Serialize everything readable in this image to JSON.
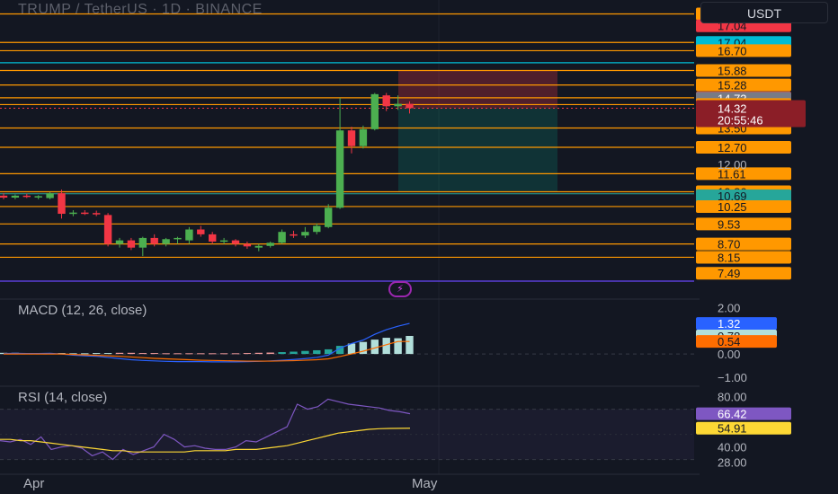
{
  "header": {
    "title": "TRUMP / TetherUS · 1D · BINANCE",
    "currency": "USDT"
  },
  "price_badges": [
    {
      "label": "18.22",
      "bg": "#ff9800",
      "fg": "#131722",
      "price": 18.22
    },
    {
      "label": "17.04",
      "bg": "#f23645",
      "fg": "#131722",
      "price": 17.73
    },
    {
      "label": "17.04",
      "bg": "#00bcd4",
      "fg": "#131722",
      "price": 17.04
    },
    {
      "label": "16.70",
      "bg": "#ff9800",
      "fg": "#131722",
      "price": 16.7
    },
    {
      "label": "15.88",
      "bg": "#ff9800",
      "fg": "#131722",
      "price": 15.88
    },
    {
      "label": "15.28",
      "bg": "#ff9800",
      "fg": "#131722",
      "price": 15.28
    },
    {
      "label": "14.75",
      "bg": "#f23645",
      "fg": "#131722",
      "price": 14.75
    },
    {
      "label": "14.73",
      "bg": "#787b86",
      "fg": "#ffffff",
      "price": 14.73
    },
    {
      "label": "14.47",
      "bg": "#ff9800",
      "fg": "#131722",
      "price": 14.47
    },
    {
      "label": "13.50",
      "bg": "#ff9800",
      "fg": "#131722",
      "price": 13.5
    },
    {
      "label": "12.70",
      "bg": "#ff9800",
      "fg": "#131722",
      "price": 12.7
    },
    {
      "label": "11.61",
      "bg": "#ff9800",
      "fg": "#131722",
      "price": 11.61
    },
    {
      "label": "10.86",
      "bg": "#ff9800",
      "fg": "#131722",
      "price": 10.86
    },
    {
      "label": "10.70",
      "bg": "#4caf50",
      "fg": "#131722",
      "price": 10.7
    },
    {
      "label": "10.69",
      "bg": "#26a69a",
      "fg": "#131722",
      "price": 10.69
    },
    {
      "label": "10.25",
      "bg": "#ff9800",
      "fg": "#131722",
      "price": 10.25
    },
    {
      "label": "9.53",
      "bg": "#ff9800",
      "fg": "#131722",
      "price": 9.53
    },
    {
      "label": "8.70",
      "bg": "#ff9800",
      "fg": "#131722",
      "price": 8.7
    },
    {
      "label": "8.15",
      "bg": "#ff9800",
      "fg": "#131722",
      "price": 8.15
    },
    {
      "label": "7.49",
      "bg": "#ff9800",
      "fg": "#131722",
      "price": 7.49
    }
  ],
  "current_price": {
    "label": "14.32",
    "countdown": "20:55:46",
    "price": 14.32
  },
  "axis_label_12": "12.00",
  "macd": {
    "label": "MACD (12, 26, close)",
    "axis": [
      "2.00",
      "0.00",
      "−1.00"
    ],
    "badges": [
      {
        "label": "1.32",
        "bg": "#2962ff",
        "fg": "#ffffff"
      },
      {
        "label": "0.78",
        "bg": "#b2dfdb",
        "fg": "#131722"
      },
      {
        "label": "0.54",
        "bg": "#ff6d00",
        "fg": "#131722"
      }
    ]
  },
  "rsi": {
    "label": "RSI (14, close)",
    "axis": [
      "80.00",
      "40.00",
      "28.00"
    ],
    "badges": [
      {
        "label": "66.42",
        "bg": "#7e57c2",
        "fg": "#ffffff"
      },
      {
        "label": "54.91",
        "bg": "#fdd835",
        "fg": "#131722"
      }
    ]
  },
  "time_axis": [
    "Apr",
    "May"
  ],
  "colors": {
    "background": "#131722",
    "up": "#4caf50",
    "down": "#f23645",
    "level_line": "#ff9800",
    "cyan_line": "#00bcd4",
    "purple_line": "#5b3fd6"
  },
  "chart_data": {
    "type": "candlestick",
    "candles": [
      {
        "o": 10.7,
        "h": 10.8,
        "l": 10.55,
        "c": 10.62
      },
      {
        "o": 10.62,
        "h": 10.75,
        "l": 10.55,
        "c": 10.7
      },
      {
        "o": 10.7,
        "h": 10.78,
        "l": 10.6,
        "c": 10.65
      },
      {
        "o": 10.65,
        "h": 10.72,
        "l": 10.55,
        "c": 10.68
      },
      {
        "o": 10.6,
        "h": 10.85,
        "l": 10.55,
        "c": 10.8
      },
      {
        "o": 10.8,
        "h": 10.95,
        "l": 9.75,
        "c": 9.95
      },
      {
        "o": 9.95,
        "h": 10.1,
        "l": 9.85,
        "c": 10.0
      },
      {
        "o": 10.0,
        "h": 10.1,
        "l": 9.9,
        "c": 9.98
      },
      {
        "o": 9.98,
        "h": 10.08,
        "l": 9.85,
        "c": 9.95
      },
      {
        "o": 9.9,
        "h": 9.98,
        "l": 8.6,
        "c": 8.7
      },
      {
        "o": 8.7,
        "h": 8.95,
        "l": 8.55,
        "c": 8.85
      },
      {
        "o": 8.85,
        "h": 8.95,
        "l": 8.45,
        "c": 8.55
      },
      {
        "o": 8.55,
        "h": 9.0,
        "l": 8.2,
        "c": 8.95
      },
      {
        "o": 8.95,
        "h": 9.1,
        "l": 8.6,
        "c": 8.7
      },
      {
        "o": 8.7,
        "h": 8.95,
        "l": 8.6,
        "c": 8.9
      },
      {
        "o": 8.9,
        "h": 9.0,
        "l": 8.7,
        "c": 8.95
      },
      {
        "o": 8.85,
        "h": 9.4,
        "l": 8.7,
        "c": 9.3
      },
      {
        "o": 9.3,
        "h": 9.45,
        "l": 9.0,
        "c": 9.1
      },
      {
        "o": 9.1,
        "h": 9.2,
        "l": 8.7,
        "c": 8.8
      },
      {
        "o": 8.8,
        "h": 8.95,
        "l": 8.7,
        "c": 8.85
      },
      {
        "o": 8.85,
        "h": 8.9,
        "l": 8.6,
        "c": 8.7
      },
      {
        "o": 8.7,
        "h": 8.8,
        "l": 8.5,
        "c": 8.6
      },
      {
        "o": 8.55,
        "h": 8.7,
        "l": 8.4,
        "c": 8.62
      },
      {
        "o": 8.62,
        "h": 8.8,
        "l": 8.55,
        "c": 8.75
      },
      {
        "o": 8.75,
        "h": 9.3,
        "l": 8.7,
        "c": 9.2
      },
      {
        "o": 9.1,
        "h": 9.25,
        "l": 8.95,
        "c": 9.05
      },
      {
        "o": 9.05,
        "h": 9.4,
        "l": 8.95,
        "c": 9.2
      },
      {
        "o": 9.2,
        "h": 9.55,
        "l": 9.1,
        "c": 9.45
      },
      {
        "o": 9.4,
        "h": 10.35,
        "l": 9.35,
        "c": 10.2
      },
      {
        "o": 10.2,
        "h": 14.75,
        "l": 10.15,
        "c": 13.4
      },
      {
        "o": 13.4,
        "h": 13.55,
        "l": 12.45,
        "c": 12.75
      },
      {
        "o": 12.75,
        "h": 13.6,
        "l": 12.65,
        "c": 13.45
      },
      {
        "o": 13.45,
        "h": 14.95,
        "l": 13.4,
        "c": 14.9
      },
      {
        "o": 14.85,
        "h": 14.95,
        "l": 14.2,
        "c": 14.4
      },
      {
        "o": 14.4,
        "h": 14.85,
        "l": 14.25,
        "c": 14.5
      },
      {
        "o": 14.5,
        "h": 14.6,
        "l": 14.1,
        "c": 14.32
      }
    ],
    "ylim": [
      7.2,
      18.5
    ],
    "levels": [
      18.22,
      17.04,
      16.7,
      15.88,
      15.28,
      14.75,
      14.47,
      14.32,
      13.5,
      12.7,
      11.61,
      10.86,
      10.25,
      9.53,
      8.7,
      8.15
    ],
    "macd_line": [
      0.02,
      0.03,
      0.02,
      0.02,
      0.03,
      0.0,
      -0.05,
      -0.08,
      -0.1,
      -0.15,
      -0.2,
      -0.25,
      -0.28,
      -0.3,
      -0.32,
      -0.33,
      -0.33,
      -0.33,
      -0.34,
      -0.34,
      -0.34,
      -0.33,
      -0.32,
      -0.3,
      -0.27,
      -0.24,
      -0.2,
      -0.15,
      -0.05,
      0.25,
      0.45,
      0.6,
      0.85,
      1.05,
      1.2,
      1.32
    ],
    "signal_line": [
      0.0,
      0.0,
      0.0,
      0.0,
      0.0,
      0.0,
      -0.02,
      -0.04,
      -0.06,
      -0.08,
      -0.1,
      -0.13,
      -0.16,
      -0.19,
      -0.21,
      -0.23,
      -0.25,
      -0.27,
      -0.28,
      -0.29,
      -0.3,
      -0.31,
      -0.31,
      -0.31,
      -0.3,
      -0.29,
      -0.27,
      -0.25,
      -0.21,
      -0.11,
      0.0,
      0.12,
      0.26,
      0.4,
      0.54,
      0.54
    ],
    "histogram": [
      0.05,
      0.05,
      0.04,
      0.04,
      0.04,
      0.04,
      0.03,
      0.03,
      0.04,
      0.04,
      0.05,
      0.05,
      0.04,
      0.04,
      0.03,
      0.03,
      0.03,
      0.03,
      0.03,
      0.03,
      0.03,
      0.04,
      0.05,
      0.06,
      0.08,
      0.1,
      0.13,
      0.16,
      0.2,
      0.35,
      0.45,
      0.52,
      0.62,
      0.7,
      0.68,
      0.78
    ],
    "macd_ylim": [
      -1.2,
      2.1
    ],
    "rsi_line": [
      45,
      44,
      46,
      42,
      48,
      38,
      40,
      41,
      39,
      33,
      36,
      30,
      38,
      34,
      37,
      40,
      50,
      46,
      40,
      41,
      39,
      38,
      38,
      40,
      45,
      44,
      48,
      52,
      56,
      74,
      70,
      72,
      78,
      76,
      74,
      73,
      72,
      71,
      69,
      68,
      66.42
    ],
    "rsi_ma": [
      46,
      46,
      45,
      45,
      44,
      43,
      42,
      41,
      40,
      39,
      38,
      37,
      37,
      36,
      36,
      36,
      36,
      36,
      36,
      37,
      37,
      37,
      37,
      38,
      38,
      38,
      39,
      40,
      41,
      43,
      45,
      47,
      49,
      51,
      52,
      53,
      54,
      54.5,
      54.7,
      54.8,
      54.91
    ],
    "rsi_ylim": [
      24,
      84
    ]
  }
}
